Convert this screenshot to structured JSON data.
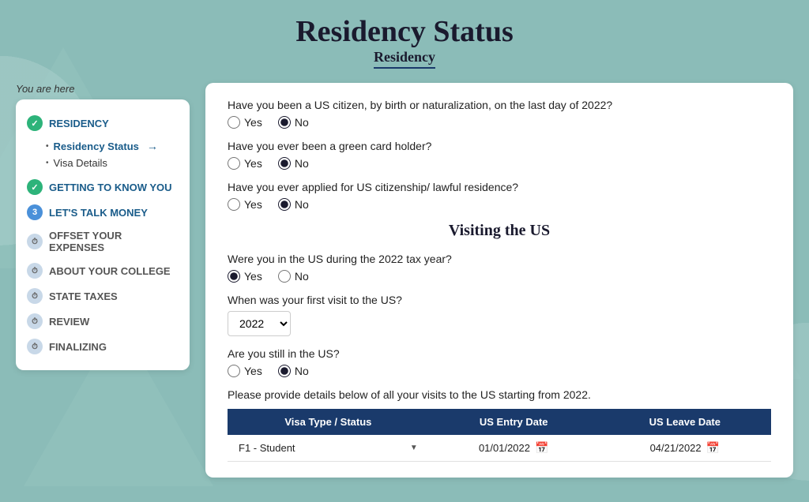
{
  "header": {
    "title": "Residency Status",
    "subtitle": "Residency"
  },
  "sidebar": {
    "you_are_here_label": "You are here",
    "nav_items": [
      {
        "id": "residency",
        "label": "RESIDENCY",
        "icon_type": "check",
        "sub_items": [
          {
            "label": "Residency Status",
            "current": true
          },
          {
            "label": "Visa Details",
            "current": false
          }
        ]
      },
      {
        "id": "getting-to-know-you",
        "label": "GETTING TO KNOW YOU",
        "icon_type": "check",
        "sub_items": []
      },
      {
        "id": "lets-talk-money",
        "label": "LET'S TALK MONEY",
        "icon_type": "number",
        "icon_value": "3",
        "sub_items": []
      },
      {
        "id": "offset-expenses",
        "label": "OFFSET YOUR EXPENSES",
        "icon_type": "clock",
        "sub_items": []
      },
      {
        "id": "about-college",
        "label": "ABOUT YOUR COLLEGE",
        "icon_type": "clock",
        "sub_items": []
      },
      {
        "id": "state-taxes",
        "label": "STATE TAXES",
        "icon_type": "clock",
        "sub_items": []
      },
      {
        "id": "review",
        "label": "REVIEW",
        "icon_type": "clock",
        "sub_items": []
      },
      {
        "id": "finalizing",
        "label": "FINALIZING",
        "icon_type": "clock",
        "sub_items": []
      }
    ]
  },
  "questions": {
    "section1_label": "",
    "q1": {
      "text": "Have you been a US citizen, by birth or naturalization, on the last day of 2022?",
      "yes_selected": false,
      "no_selected": true
    },
    "q2": {
      "text": "Have you ever been a green card holder?",
      "yes_selected": false,
      "no_selected": true
    },
    "q3": {
      "text": "Have you ever applied for US citizenship/ lawful residence?",
      "yes_selected": false,
      "no_selected": true
    },
    "section2_label": "Visiting the US",
    "q4": {
      "text": "Were you in the US during the 2022 tax year?",
      "yes_selected": true,
      "no_selected": false
    },
    "q5": {
      "text": "When was your first visit to the US?",
      "year_value": "2022"
    },
    "q6": {
      "text": "Are you still in the US?",
      "yes_selected": false,
      "no_selected": true
    },
    "table_label": "Please provide details below of all your visits to the US starting from 2022.",
    "table": {
      "headers": [
        "Visa Type / Status",
        "US Entry Date",
        "US Leave Date"
      ],
      "rows": [
        {
          "visa_type": "F1 - Student",
          "entry_date": "01/01/2022",
          "leave_date": "04/21/2022"
        }
      ]
    }
  }
}
